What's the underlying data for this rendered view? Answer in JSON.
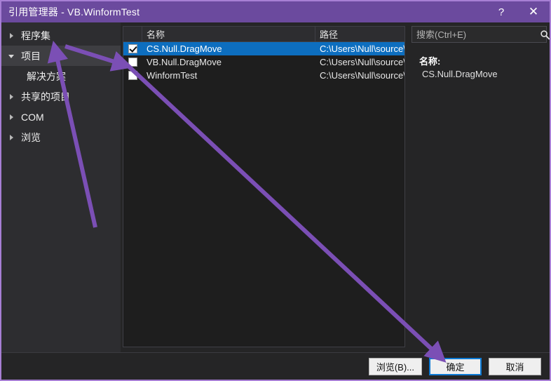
{
  "window": {
    "title": "引用管理器 - VB.WinformTest",
    "help_label": "?",
    "close_label": "✕",
    "accent_color": "#6b4a9e",
    "border_color": "#a77fd4",
    "annotation_color": "#7b4fb5"
  },
  "sidebar": {
    "items": [
      {
        "label": "程序集",
        "state": "collapsed",
        "level": 0,
        "selected": false
      },
      {
        "label": "项目",
        "state": "expanded",
        "level": 0,
        "selected": true
      },
      {
        "label": "解决方案",
        "state": "leaf",
        "level": 1,
        "selected": false
      },
      {
        "label": "共享的项目",
        "state": "collapsed",
        "level": 0,
        "selected": false
      },
      {
        "label": "COM",
        "state": "collapsed",
        "level": 0,
        "selected": false
      },
      {
        "label": "浏览",
        "state": "collapsed",
        "level": 0,
        "selected": false
      }
    ]
  },
  "list": {
    "columns": [
      "名称",
      "路径"
    ],
    "rows": [
      {
        "checked": true,
        "name": "CS.Null.DragMove",
        "path": "C:\\Users\\Null\\source\\...",
        "selected": true
      },
      {
        "checked": false,
        "name": "VB.Null.DragMove",
        "path": "C:\\Users\\Null\\source\\...",
        "selected": false
      },
      {
        "checked": false,
        "name": "WinformTest",
        "path": "C:\\Users\\Null\\source\\...",
        "selected": false
      }
    ],
    "selection_color": "#0d6ebf"
  },
  "search": {
    "value": "",
    "placeholder": "搜索(Ctrl+E)",
    "icon": "search-icon",
    "dropdown_icon": "chevron-down-icon"
  },
  "detail": {
    "label": "名称:",
    "value": "CS.Null.DragMove"
  },
  "footer": {
    "browse_label": "浏览(B)...",
    "ok_label": "确定",
    "cancel_label": "取消"
  }
}
